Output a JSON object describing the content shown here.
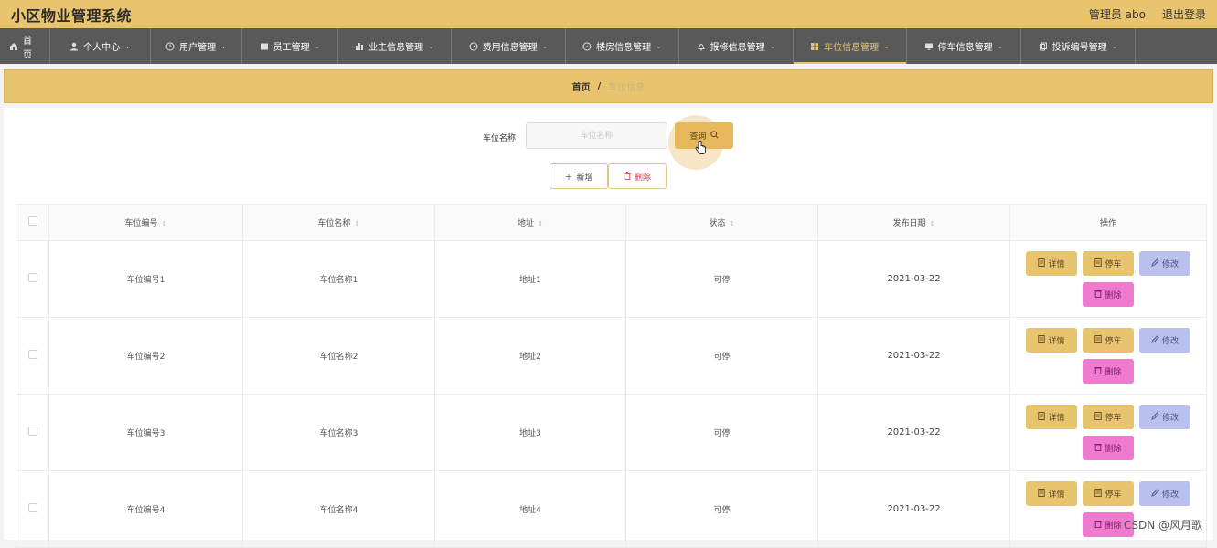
{
  "header": {
    "title": "小区物业管理系统",
    "user": "管理员 abo",
    "logout": "退出登录"
  },
  "nav": {
    "items": [
      {
        "label": "首页",
        "icon": "home-icon"
      },
      {
        "label": "个人中心",
        "icon": "user-icon"
      },
      {
        "label": "用户管理",
        "icon": "clock-icon"
      },
      {
        "label": "员工管理",
        "icon": "card-icon"
      },
      {
        "label": "业主信息管理",
        "icon": "bar-chart-icon"
      },
      {
        "label": "费用信息管理",
        "icon": "gauge-icon"
      },
      {
        "label": "楼房信息管理",
        "icon": "compass-icon"
      },
      {
        "label": "报修信息管理",
        "icon": "bell-icon"
      },
      {
        "label": "车位信息管理",
        "icon": "grid-icon"
      },
      {
        "label": "停车信息管理",
        "icon": "monitor-icon"
      },
      {
        "label": "投诉编号管理",
        "icon": "copy-icon"
      }
    ],
    "active_index": 8
  },
  "breadcrumb": {
    "home": "首页",
    "sep": "/",
    "current": "车位信息"
  },
  "search": {
    "label": "车位名称",
    "placeholder": "车位名称",
    "query_label": "查询"
  },
  "actions": {
    "add_label": "新增",
    "delete_label": "删除"
  },
  "table": {
    "columns": [
      "车位编号",
      "车位名称",
      "地址",
      "状态",
      "发布日期",
      "操作"
    ],
    "rows": [
      {
        "code": "车位编号1",
        "name": "车位名称1",
        "address": "地址1",
        "status": "可停",
        "date": "2021-03-22"
      },
      {
        "code": "车位编号2",
        "name": "车位名称2",
        "address": "地址2",
        "status": "可停",
        "date": "2021-03-22"
      },
      {
        "code": "车位编号3",
        "name": "车位名称3",
        "address": "地址3",
        "status": "可停",
        "date": "2021-03-22"
      },
      {
        "code": "车位编号4",
        "name": "车位名称4",
        "address": "地址4",
        "status": "可停",
        "date": "2021-03-22"
      }
    ],
    "row_actions": {
      "detail": "详情",
      "park": "停车",
      "edit": "修改",
      "remove": "删除"
    }
  },
  "watermark": "CSDN @风月歌",
  "colors": {
    "brand": "#e8c46f",
    "nav_bg": "#595959",
    "edit_btn": "#b9c0ee",
    "delete_btn": "#f07ad0"
  }
}
